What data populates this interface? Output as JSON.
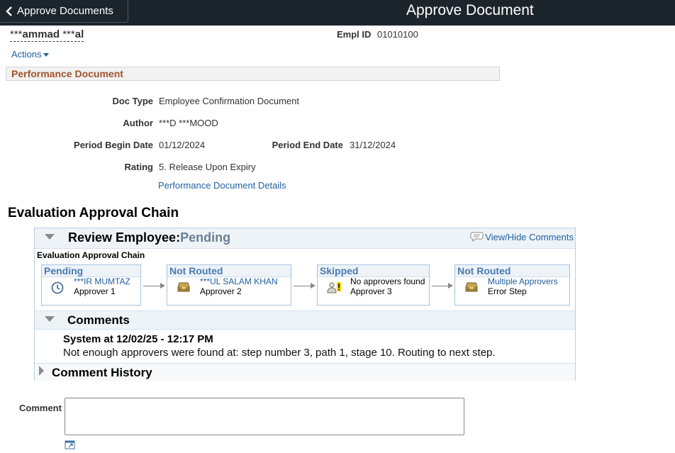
{
  "header": {
    "back_label": "Approve Documents",
    "page_title": "Approve Document"
  },
  "employee": {
    "name_prefix1": "***",
    "name_part1": "ammad",
    "name_prefix2": " ***",
    "name_part2": "al",
    "emplid_label": "Empl ID",
    "emplid_value": "01010100"
  },
  "actions_label": "Actions",
  "section_title": "Performance Document",
  "fields": {
    "doc_type_label": "Doc Type",
    "doc_type_value": "Employee Confirmation Document",
    "author_label": "Author",
    "author_value": "***D ***MOOD",
    "period_begin_label": "Period Begin Date",
    "period_begin_value": "01/12/2024",
    "period_end_label": "Period End Date",
    "period_end_value": "31/12/2024",
    "rating_label": "Rating",
    "rating_value": "5. Release Upon Expiry",
    "details_link": "Performance Document Details"
  },
  "approval": {
    "heading": "Evaluation Approval Chain",
    "review_label": "Review Employee:",
    "review_status": "Pending",
    "view_hide": "View/Hide Comments",
    "chain_label": "Evaluation Approval Chain",
    "steps": [
      {
        "status": "Pending",
        "name": "***IR MUMTAZ",
        "role": "Approver 1",
        "icon": "clock-icon"
      },
      {
        "status": "Not Routed",
        "name": "***UL SALAM KHAN",
        "role": "Approver 2",
        "icon": "inbox-icon"
      },
      {
        "status": "Skipped",
        "name": "No approvers found",
        "role": "Approver 3",
        "icon": "warning-user-icon"
      },
      {
        "status": "Not Routed",
        "name": "Multiple Approvers",
        "role": "Error Step",
        "icon": "inbox-icon"
      }
    ],
    "comments_title": "Comments",
    "comment_by": "System at 12/02/25 - 12:17 PM",
    "comment_text": "Not enough approvers were found at: step number 3, path 1, stage 10. Routing to next step.",
    "history_title": "Comment History"
  },
  "comment_field": {
    "label": "Comment",
    "value": ""
  }
}
